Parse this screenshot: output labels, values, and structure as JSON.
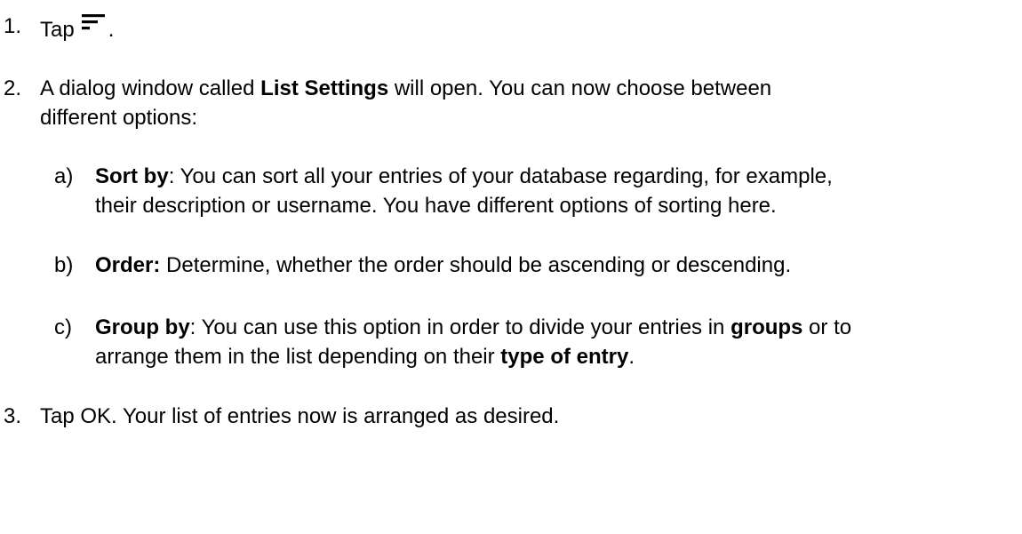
{
  "steps": [
    {
      "number": "1.",
      "text_before": "Tap",
      "icon": "sort-lines-icon",
      "text_after": "."
    },
    {
      "number": "2.",
      "line1_pre": "A dialog window called ",
      "line1_bold": "List Settings",
      "line1_post": " will open. You can now choose between",
      "line2": "different options:"
    },
    {
      "number": "3.",
      "text": "Tap OK. Your list of entries now is arranged as desired."
    }
  ],
  "options": [
    {
      "letter": "a)",
      "bold": "Sort by",
      "line1": ": You can sort all your entries of your database regarding, for example,",
      "line2": "their description or username. You have different options of sorting here."
    },
    {
      "letter": "b)",
      "bold": "Order:",
      "line1": " Determine, whether the order should be ascending or descending."
    },
    {
      "letter": "c)",
      "bold": "Group by",
      "line1_a": ": You can use this option in order to divide your entries in ",
      "line1_bold": "groups",
      "line1_b": " or to",
      "line2_a": "arrange them in the list depending on their ",
      "line2_bold": "type of entry",
      "line2_b": "."
    }
  ]
}
